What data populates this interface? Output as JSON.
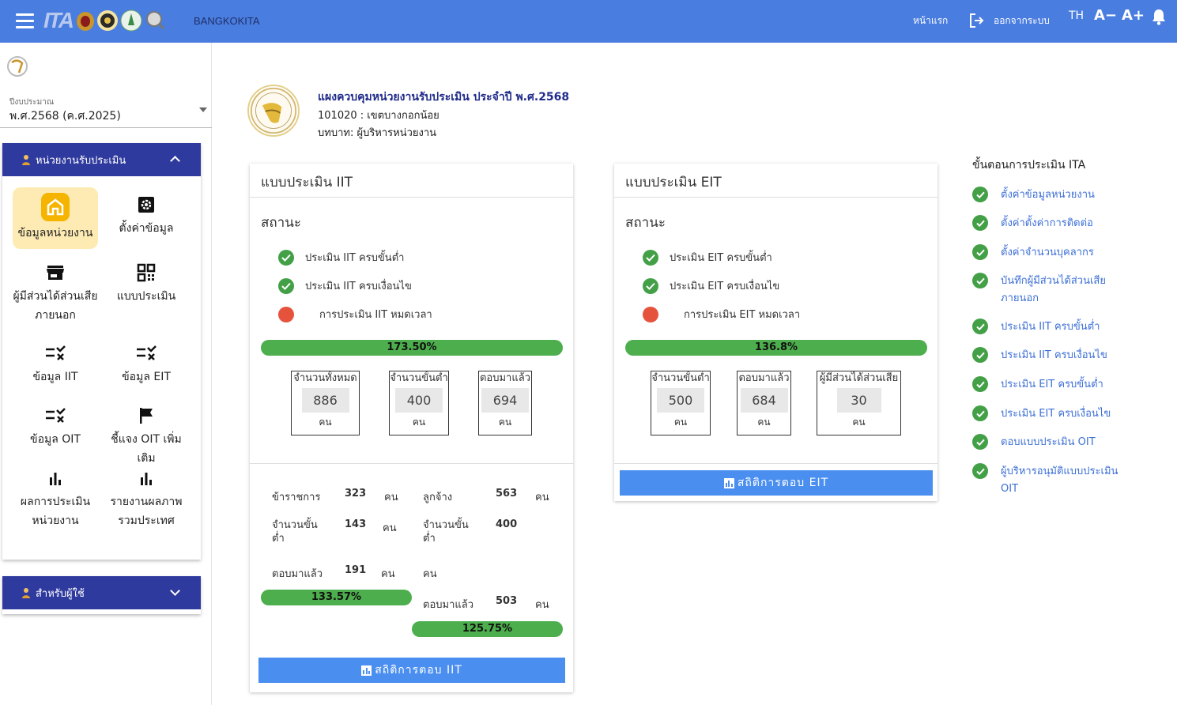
{
  "header": {
    "brand": "BANGKOKITA",
    "nav_home": "หน้าแรก",
    "nav_logout": "ออกจากระบบ",
    "lang": "TH",
    "font_down": "A−",
    "font_up": "A+"
  },
  "sidebar": {
    "fiscal_label": "ปีงบประมาณ",
    "fiscal_value": "พ.ศ.2568 (ค.ศ.2025)",
    "panel1_title": "หน่วยงานรับประเมิน",
    "panel2_title": "สำหรับผู้ใช้",
    "tiles": [
      {
        "label": "ข้อมูลหน่วยงาน",
        "icon": "home-icon"
      },
      {
        "label": "ตั้งค่าข้อมูล",
        "icon": "settings-icon"
      },
      {
        "label": "ผู้มีส่วนได้ส่วนเสียภายนอก",
        "icon": "store-icon"
      },
      {
        "label": "แบบประเมิน",
        "icon": "qr-code-icon"
      },
      {
        "label": "ข้อมูล IIT",
        "icon": "checklist-icon"
      },
      {
        "label": "ข้อมูล EIT",
        "icon": "checklist-icon"
      },
      {
        "label": "ข้อมูล OIT",
        "icon": "checklist-icon"
      },
      {
        "label": "ชี้แจง OIT เพิ่มเติม",
        "icon": "flag-icon"
      },
      {
        "label": "ผลการประเมินหน่วยงาน",
        "icon": "bar-chart-icon"
      },
      {
        "label": "รายงานผลภาพรวมประเทศ",
        "icon": "bar-chart-icon"
      }
    ]
  },
  "main": {
    "title": "แผงควบคุมหน่วยงานรับประเมิน ประจำปี พ.ศ.2568",
    "org": "101020 : เขตบางกอกน้อย",
    "role": "บทบาท: ผู้บริหารหน่วยงาน"
  },
  "iit": {
    "title": "แบบประเมิน IIT",
    "status_heading": "สถานะ",
    "statuses": [
      "ประเมิน IIT ครบขั้นต่ำ",
      "ประเมิน IIT ครบเงื่อนไข",
      "การประเมิน IIT หมดเวลา"
    ],
    "progress": "173.50%",
    "progress_value": 173.5,
    "boxes": [
      {
        "label": "จำนวนทั้งหมด",
        "value": "886",
        "unit": "คน"
      },
      {
        "label": "จำนวนขั้นต่ำ",
        "value": "400",
        "unit": "คน"
      },
      {
        "label": "ตอบมาแล้ว",
        "value": "694",
        "unit": "คน"
      }
    ],
    "gov_label": "ข้าราชการ",
    "gov_total": "323",
    "gov_min_label": "จำนวนขั้นต่ำ",
    "gov_min": "143",
    "gov_answered_label": "ตอบมาแล้ว",
    "gov_answered": "191",
    "gov_progress": "133.57%",
    "gov_progress_value": 133.57,
    "emp_label": "ลูกจ้าง",
    "emp_total": "563",
    "emp_min_label": "จำนวนขั้นต่ำ",
    "emp_min": "400",
    "emp_answered_label": "ตอบมาแล้ว",
    "emp_answered": "503",
    "emp_progress": "125.75%",
    "emp_progress_value": 125.75,
    "unit": "คน",
    "button": "สถิติการตอบ IIT"
  },
  "eit": {
    "title": "แบบประเมิน EIT",
    "status_heading": "สถานะ",
    "statuses": [
      "ประเมิน EIT ครบขั้นต่ำ",
      "ประเมิน EIT ครบเงื่อนไข",
      "การประเมิน EIT หมดเวลา"
    ],
    "progress": "136.8%",
    "progress_value": 136.8,
    "boxes": [
      {
        "label": "จำนวนขั้นต่ำ",
        "value": "500",
        "unit": "คน"
      },
      {
        "label": "ตอบมาแล้ว",
        "value": "684",
        "unit": "คน"
      },
      {
        "label": "ผู้มีส่วนได้ส่วนเสีย",
        "value": "30",
        "unit": "คน"
      }
    ],
    "button": "สถิติการตอบ EIT"
  },
  "steps": {
    "title": "ขั้นตอนการประเมิน ITA",
    "items": [
      "ตั้งค่าข้อมูลหน่วยงาน",
      "ตั้งค่าตั้งค่าการติดต่อ",
      "ตั้งค่าจำนวนบุคลากร",
      "บันทึกผู้มีส่วนได้ส่วนเสียภายนอก",
      "ประเมิน IIT ครบขั้นต่ำ",
      "ประเมิน IIT ครบเงื่อนไข",
      "ประเมิน EIT ครบขั้นต่ำ",
      "ประเมิน EIT ครบเงื่อนไข",
      "ตอบแบบประเมิน OIT",
      "ผู้บริหารอนุมัติแบบประเมิน OIT"
    ]
  },
  "colors": {
    "primary": "#4a7de0",
    "panel": "#2f3a9e",
    "success": "#43a047",
    "error": "#e5533d",
    "progress": "#4cae4c",
    "link": "#3c6fd6"
  }
}
